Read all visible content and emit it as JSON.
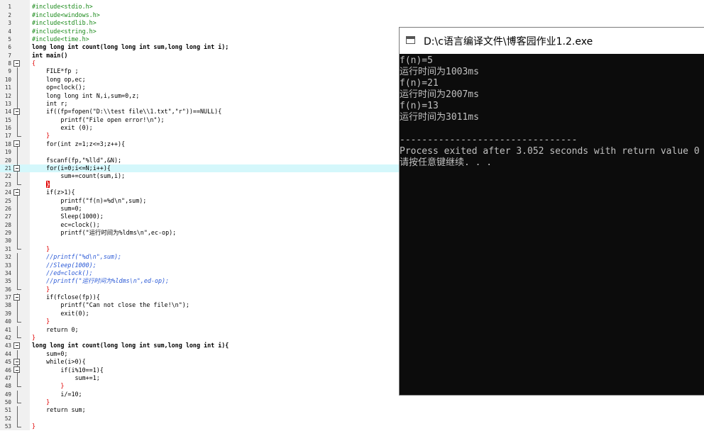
{
  "editor": {
    "lines": [
      {
        "n": "1",
        "code": "#include<stdio.h>",
        "kind": "pp"
      },
      {
        "n": "2",
        "code": "#include<windows.h>",
        "kind": "pp"
      },
      {
        "n": "3",
        "code": "#include<stdlib.h>",
        "kind": "pp"
      },
      {
        "n": "4",
        "code": "#include<string.h>",
        "kind": "pp"
      },
      {
        "n": "5",
        "code": "#include<time.h>",
        "kind": "pp"
      },
      {
        "n": "6",
        "code": "long long int count(long long int sum,long long int i);",
        "kind": "kw"
      },
      {
        "n": "7",
        "code": "int main()",
        "kind": "kw"
      },
      {
        "n": "8",
        "code": "{",
        "kind": "red"
      },
      {
        "n": "9",
        "code": "    FILE*fp ;",
        "kind": "plain"
      },
      {
        "n": "10",
        "code": "    long op,ec;",
        "kind": "plain"
      },
      {
        "n": "11",
        "code": "    op=clock();",
        "kind": "plain"
      },
      {
        "n": "12",
        "code": "    long long int N,i,sum=0,z;",
        "kind": "plain"
      },
      {
        "n": "13",
        "code": "    int r;",
        "kind": "plain"
      },
      {
        "n": "14",
        "code": "    if((fp=fopen(\"D:\\\\test file\\\\1.txt\",\"r\"))==NULL){",
        "kind": "plain"
      },
      {
        "n": "15",
        "code": "        printf(\"File open error!\\n\");",
        "kind": "plain"
      },
      {
        "n": "16",
        "code": "        exit (0);",
        "kind": "plain"
      },
      {
        "n": "17",
        "code": "    }",
        "kind": "red"
      },
      {
        "n": "18",
        "code": "    for(int z=1;z<=3;z++){",
        "kind": "plain"
      },
      {
        "n": "19",
        "code": "",
        "kind": "plain"
      },
      {
        "n": "20",
        "code": "    fscanf(fp,\"%lld\",&N);",
        "kind": "plain"
      },
      {
        "n": "21",
        "code": "    for(i=0;i<=N;i++){",
        "kind": "plain"
      },
      {
        "n": "22",
        "code": "        sum+=count(sum,i);",
        "kind": "plain"
      },
      {
        "n": "23",
        "code": "    }",
        "kind": "mark"
      },
      {
        "n": "24",
        "code": "    if(z>1){",
        "kind": "plain"
      },
      {
        "n": "25",
        "code": "        printf(\"f(n)=%d\\n\",sum);",
        "kind": "plain"
      },
      {
        "n": "26",
        "code": "        sum=0;",
        "kind": "plain"
      },
      {
        "n": "27",
        "code": "        Sleep(1000);",
        "kind": "plain"
      },
      {
        "n": "28",
        "code": "        ec=clock();",
        "kind": "plain"
      },
      {
        "n": "29",
        "code": "        printf(\"运行时间为%ldms\\n\",ec-op);",
        "kind": "plain"
      },
      {
        "n": "30",
        "code": "",
        "kind": "plain"
      },
      {
        "n": "31",
        "code": "    }",
        "kind": "red"
      },
      {
        "n": "32",
        "code": "    //printf(\"%d\\n\",sum);",
        "kind": "cm"
      },
      {
        "n": "33",
        "code": "    //Sleep(1000);",
        "kind": "cm"
      },
      {
        "n": "34",
        "code": "    //ed=clock();",
        "kind": "cm"
      },
      {
        "n": "35",
        "code": "    //printf(\"运行时间为%ldms\\n\",ed-op);",
        "kind": "cm"
      },
      {
        "n": "36",
        "code": "    }",
        "kind": "red"
      },
      {
        "n": "37",
        "code": "    if(fclose(fp)){",
        "kind": "plain"
      },
      {
        "n": "38",
        "code": "        printf(\"Can not close the file!\\n\");",
        "kind": "plain"
      },
      {
        "n": "39",
        "code": "        exit(0);",
        "kind": "plain"
      },
      {
        "n": "40",
        "code": "    }",
        "kind": "red"
      },
      {
        "n": "41",
        "code": "    return 0;",
        "kind": "plain"
      },
      {
        "n": "42",
        "code": "}",
        "kind": "red"
      },
      {
        "n": "43",
        "code": "long long int count(long long int sum,long long int i){",
        "kind": "kw"
      },
      {
        "n": "44",
        "code": "    sum=0;",
        "kind": "plain"
      },
      {
        "n": "45",
        "code": "    while(i>0){",
        "kind": "plain"
      },
      {
        "n": "46",
        "code": "        if(i%10==1){",
        "kind": "plain"
      },
      {
        "n": "47",
        "code": "            sum+=1;",
        "kind": "plain"
      },
      {
        "n": "48",
        "code": "        }",
        "kind": "red"
      },
      {
        "n": "49",
        "code": "        i/=10;",
        "kind": "plain"
      },
      {
        "n": "50",
        "code": "    }",
        "kind": "red"
      },
      {
        "n": "51",
        "code": "    return sum;",
        "kind": "plain"
      },
      {
        "n": "52",
        "code": "",
        "kind": "plain"
      },
      {
        "n": "53",
        "code": "}",
        "kind": "red"
      }
    ],
    "highlighted_line": "21",
    "fold_lines": [
      "8",
      "14",
      "18",
      "21",
      "24",
      "37",
      "43",
      "45",
      "46"
    ]
  },
  "console": {
    "title": "D:\\c语言编译文件\\博客园作业1.2.exe",
    "output": [
      "f(n)=5",
      "运行时间为1003ms",
      "f(n)=21",
      "运行时间为2007ms",
      "f(n)=13",
      "运行时间为3011ms",
      "",
      "--------------------------------",
      "Process exited after 3.052 seconds with return value 0",
      "请按任意键继续. . ."
    ]
  }
}
